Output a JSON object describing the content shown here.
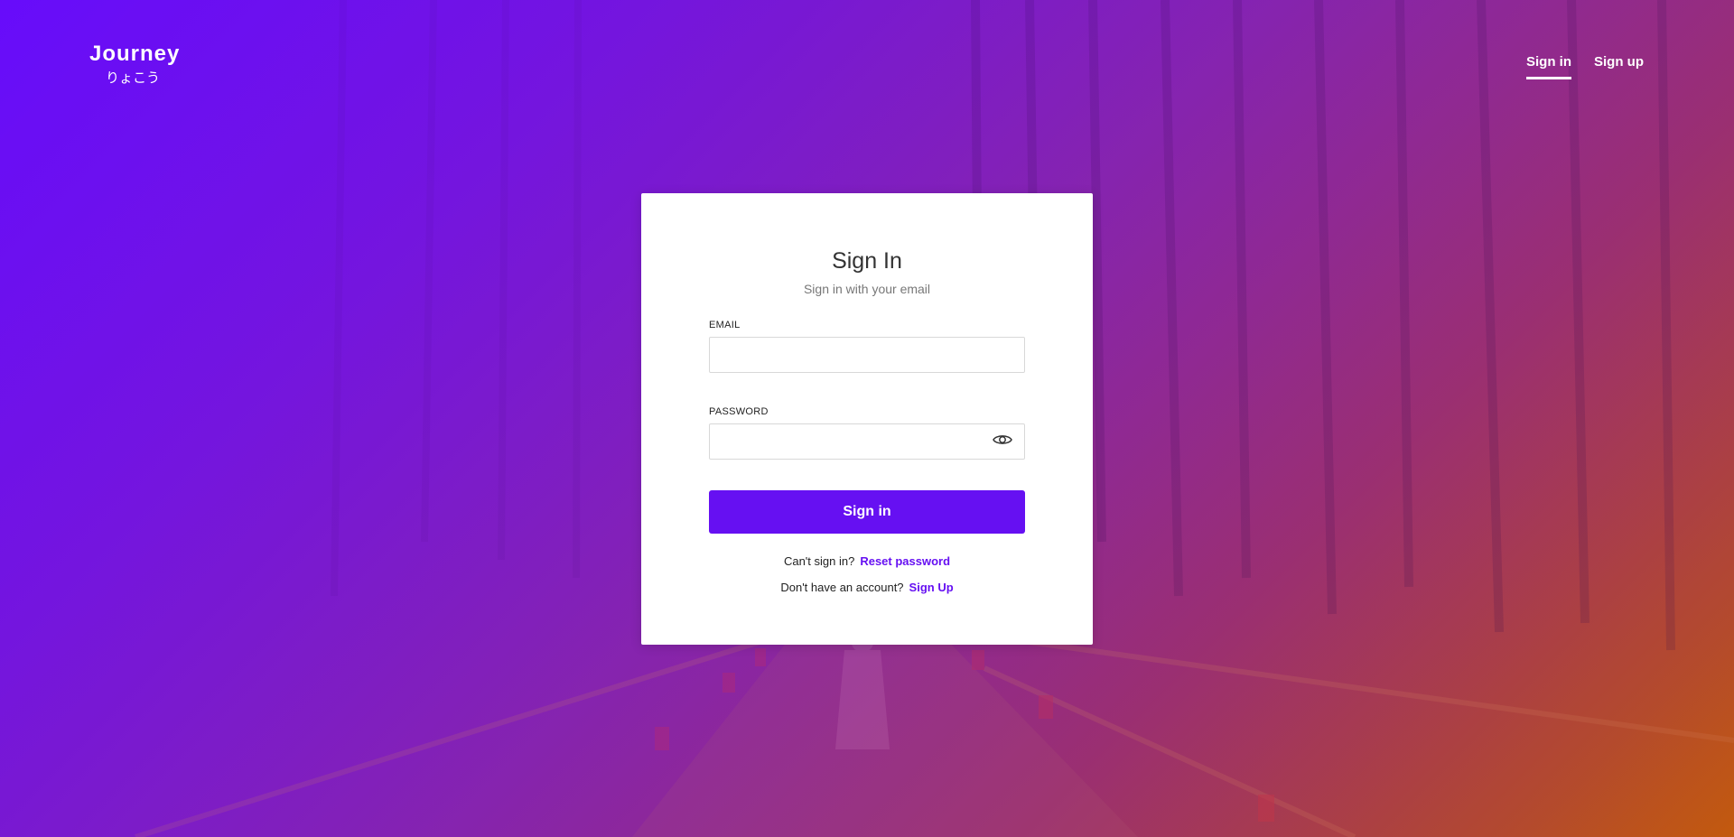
{
  "header": {
    "logo_title": "Journey",
    "logo_subtitle": "りょこう",
    "nav": {
      "sign_in": "Sign in",
      "sign_up": "Sign up"
    }
  },
  "card": {
    "title": "Sign In",
    "subtitle": "Sign in with your email",
    "email_label": "EMAIL",
    "email_value": "",
    "password_label": "PASSWORD",
    "password_value": "",
    "submit_label": "Sign in",
    "cant_sign_in": "Can't sign in?",
    "reset_link": "Reset password",
    "no_account": "Don't have an account?",
    "sign_up_link": "Sign Up"
  },
  "icons": {
    "password_toggle": "eye-icon"
  },
  "colors": {
    "accent": "#6610f2",
    "gradient_start": "#6a0ff5",
    "gradient_end": "#c05a10"
  }
}
